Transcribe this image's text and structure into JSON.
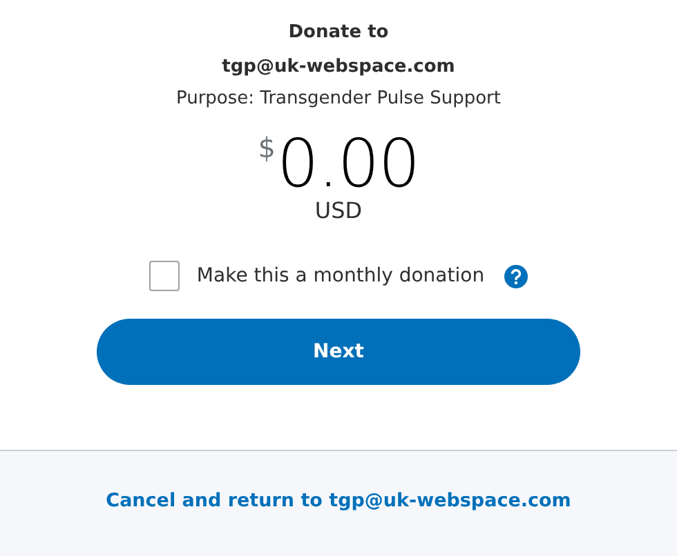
{
  "heading": "Donate to",
  "recipient": "tgp@uk-webspace.com",
  "purpose": "Purpose: Transgender Pulse Support",
  "amount": {
    "currency_symbol": "$",
    "value": "0.00",
    "currency": "USD"
  },
  "monthly": {
    "label": "Make this a monthly donation",
    "checked": false
  },
  "next_button": "Next",
  "cancel_link": "Cancel and return to tgp@uk-webspace.com"
}
